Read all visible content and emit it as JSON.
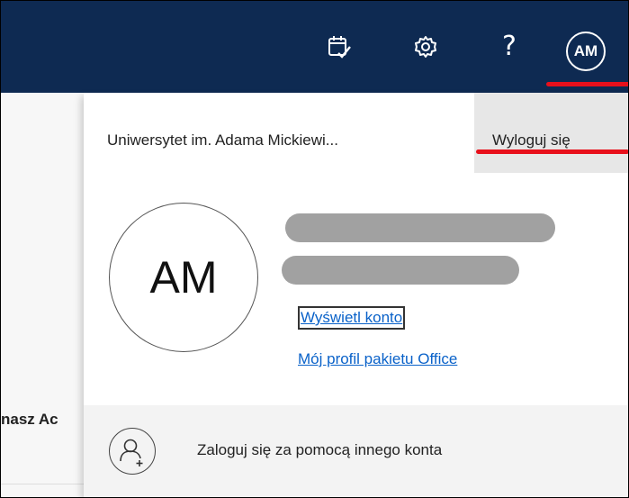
{
  "header": {
    "avatar_initials": "AM",
    "help_glyph": "?",
    "icons": [
      "calendar-check-icon",
      "gear-icon",
      "help-icon"
    ]
  },
  "background": {
    "partial_label": "nasz Ac"
  },
  "account_panel": {
    "organization": "Uniwersytet im. Adama Mickiewi...",
    "sign_out": "Wyloguj się",
    "avatar_initials": "AM",
    "view_account": "Wyświetl konto",
    "office_profile": "Mój profil pakietu Office",
    "other_account": "Zaloguj się za pomocą innego konta"
  },
  "colors": {
    "header_bg": "#0e2a52",
    "link": "#0a62c9",
    "annotation_red": "#e8101b",
    "redaction_gray": "#a1a1a1"
  }
}
